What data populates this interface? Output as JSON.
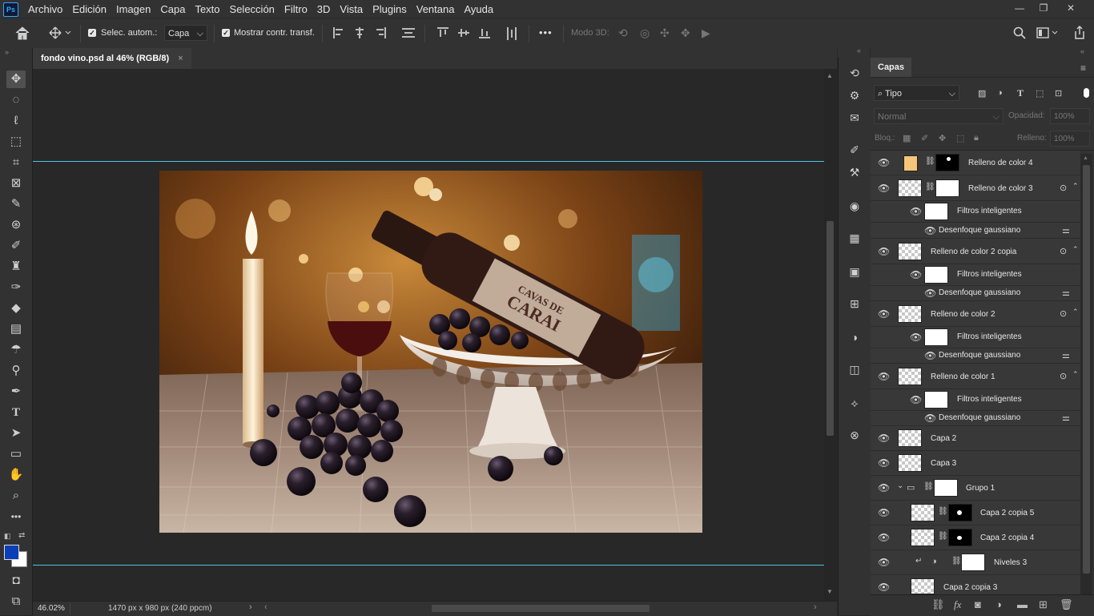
{
  "app": {
    "logo": "Ps"
  },
  "menu": [
    "Archivo",
    "Edición",
    "Imagen",
    "Capa",
    "Texto",
    "Selección",
    "Filtro",
    "3D",
    "Vista",
    "Plugins",
    "Ventana",
    "Ayuda"
  ],
  "window_controls": {
    "minimize": "—",
    "restore": "❐",
    "close": "✕"
  },
  "options": {
    "auto_select_label": "Selec. autom.:",
    "auto_select_value": "Capa",
    "show_transform_label": "Mostrar contr. transf.",
    "more": "•••",
    "mode3d_label": "Modo 3D:"
  },
  "document": {
    "tab_title": "fondo vino.psd al 46% (RGB/8)",
    "tab_close": "×",
    "zoom": "46.02%",
    "dimensions": "1470 px x 980 px (240 ppcm)",
    "bottle_label_line1": "CAVAS DE",
    "bottle_label_line2": "CARAI"
  },
  "layers_panel": {
    "tab": "Capas",
    "filter_kind": "Tipo",
    "blend_mode": "Normal",
    "opacity_label": "Opacidad:",
    "opacity_value": "100%",
    "lock_label": "Bloq.:",
    "fill_label": "Relleno:",
    "fill_value": "100%",
    "layers": [
      {
        "name": "Relleno de color 4"
      },
      {
        "name": "Relleno de color 3"
      },
      {
        "name": "Filtros inteligentes"
      },
      {
        "name": "Desenfoque gaussiano"
      },
      {
        "name": "Relleno de color 2 copia"
      },
      {
        "name": "Filtros inteligentes"
      },
      {
        "name": "Desenfoque gaussiano"
      },
      {
        "name": "Relleno de color 2"
      },
      {
        "name": "Filtros inteligentes"
      },
      {
        "name": "Desenfoque gaussiano"
      },
      {
        "name": "Relleno de color 1"
      },
      {
        "name": "Filtros inteligentes"
      },
      {
        "name": "Desenfoque gaussiano"
      },
      {
        "name": "Capa 2"
      },
      {
        "name": "Capa 3"
      },
      {
        "name": "Grupo 1"
      },
      {
        "name": "Capa 2 copia 5"
      },
      {
        "name": "Capa 2 copia 4"
      },
      {
        "name": "Niveles 3"
      },
      {
        "name": "Capa 2 copia 3"
      }
    ]
  },
  "colors": {
    "foreground": "#0b3fb5",
    "background": "#ffffff",
    "guide": "#4ec3e0",
    "fill4_swatch": "#f5c57a"
  }
}
